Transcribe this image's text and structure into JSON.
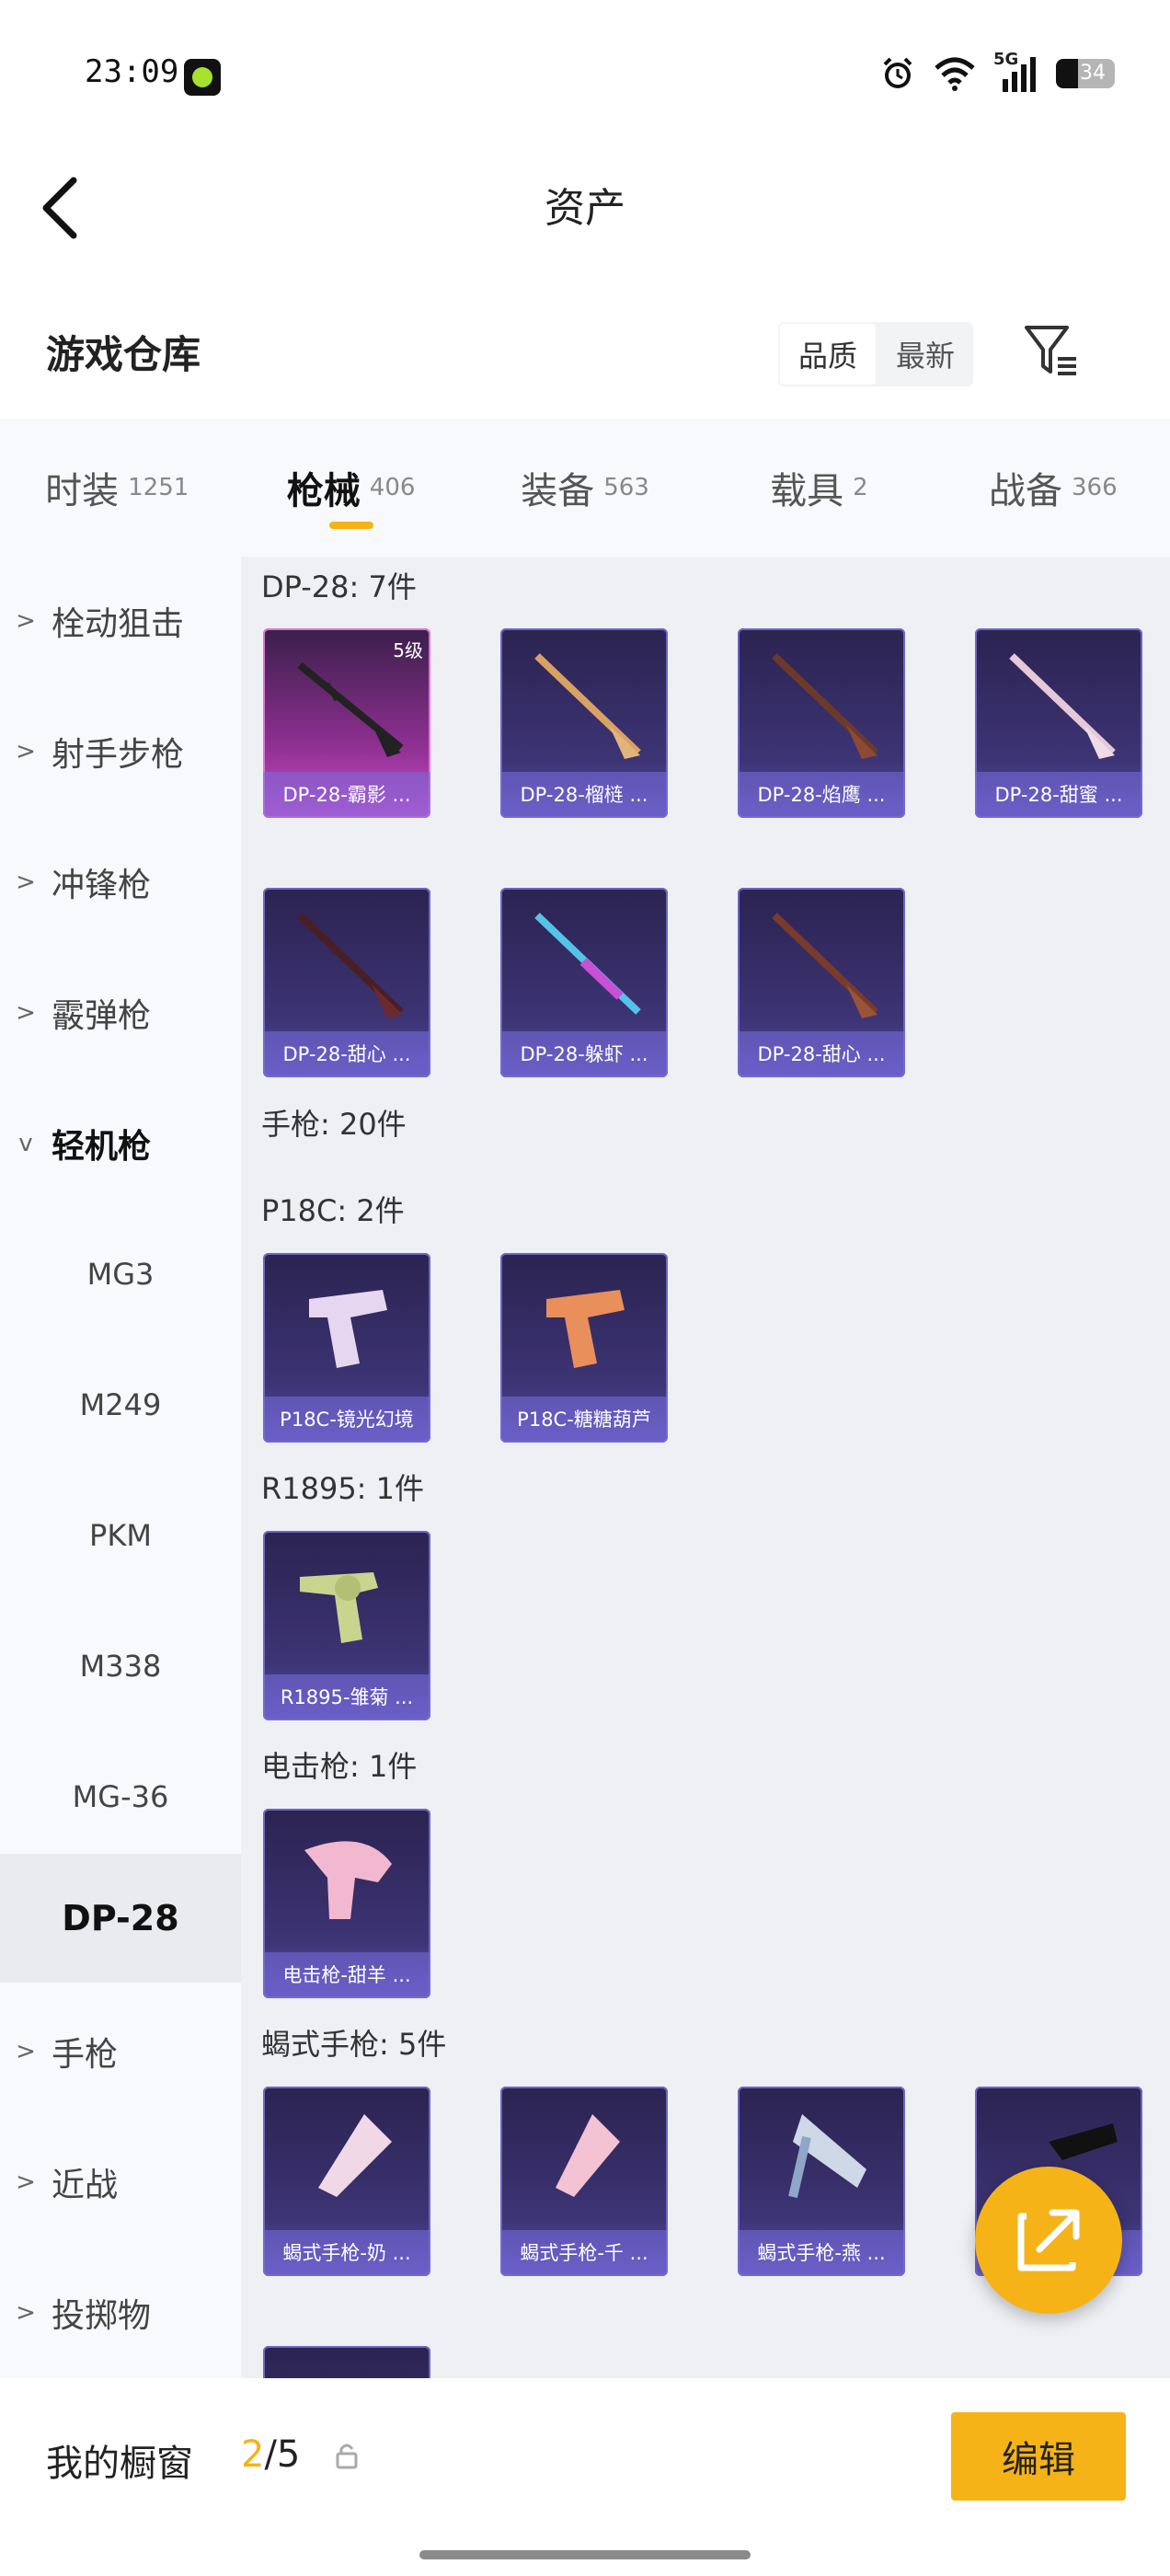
{
  "status_bar": {
    "time": "23:09",
    "battery": "34",
    "network": "5G"
  },
  "header": {
    "title": "资产"
  },
  "warehouse": {
    "title": "游戏仓库",
    "sort_options": [
      "品质",
      "最新"
    ]
  },
  "tabs": [
    {
      "label": "时装",
      "count": "1251"
    },
    {
      "label": "枪械",
      "count": "406"
    },
    {
      "label": "装备",
      "count": "563"
    },
    {
      "label": "载具",
      "count": "2"
    },
    {
      "label": "战备",
      "count": "366"
    }
  ],
  "sidebar": {
    "items": [
      {
        "label": "栓动狙击"
      },
      {
        "label": "射手步枪"
      },
      {
        "label": "冲锋枪"
      },
      {
        "label": "霰弹枪"
      },
      {
        "label": "轻机枪"
      },
      {
        "label": "MG3"
      },
      {
        "label": "M249"
      },
      {
        "label": "PKM"
      },
      {
        "label": "M338"
      },
      {
        "label": "MG-36"
      },
      {
        "label": "DP-28"
      },
      {
        "label": "手枪"
      },
      {
        "label": "近战"
      },
      {
        "label": "投掷物"
      }
    ]
  },
  "groups": [
    {
      "title": "DP-28: 7件",
      "items": [
        "DP-28-霸影 ...",
        "DP-28-榴梿 ...",
        "DP-28-焰鹰 ...",
        "DP-28-甜蜜 ...",
        "DP-28-甜心 ...",
        "DP-28-躲虾 ...",
        "DP-28-甜心 ..."
      ],
      "first_badge": "5级"
    },
    {
      "title": "手枪: 20件"
    },
    {
      "title": "P18C: 2件",
      "items": [
        "P18C-镜光幻境",
        "P18C-糖糖葫芦"
      ]
    },
    {
      "title": "R1895: 1件",
      "items": [
        "R1895-雏菊 ..."
      ]
    },
    {
      "title": "电击枪: 1件",
      "items": [
        "电击枪-甜羊 ..."
      ]
    },
    {
      "title": "蝎式手枪: 5件",
      "items": [
        "蝎式手枪-奶 ...",
        "蝎式手枪-千 ...",
        "蝎式手枪-燕 ...",
        "..."
      ]
    }
  ],
  "bottom_bar": {
    "label": "我的橱窗",
    "current": "2",
    "total": "/5",
    "edit_label": "编辑"
  },
  "colors": {
    "accent": "#f5b318",
    "card_purple": "#3d3475",
    "card_pink": "#b63fb2"
  },
  "icons": {
    "back": "chevron-left-icon",
    "filter": "filter-icon",
    "fab": "share-external-icon",
    "lock": "lock-icon"
  }
}
